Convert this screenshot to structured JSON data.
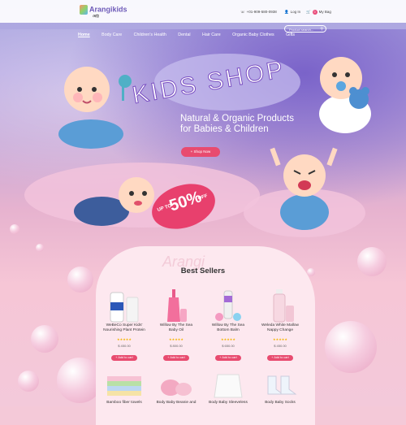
{
  "header": {
    "logo_text": "Arangikids",
    "logo_sub": "ছোট্ট",
    "phone": "+01-909-580-0938",
    "login": "Log In",
    "bag_count": "0",
    "bag": "My Bag"
  },
  "nav": {
    "items": [
      "Home",
      "Body Care",
      "Children's Health",
      "Dental",
      "Hair Care",
      "Organic Baby Clothes",
      "Gifts"
    ],
    "active": "Home",
    "search_placeholder": "Product search..."
  },
  "hero": {
    "title": "KIDS SHOP",
    "headline_line1": "Natural & Organic Products",
    "headline_line2": "for Babies & Children",
    "cta": "+ Shop Now",
    "promo_upto": "UP TO",
    "promo_pct": "50%",
    "promo_off": "OFF"
  },
  "best_sellers": {
    "title": "Best Sellers",
    "watermark": "Arangi",
    "products": [
      {
        "name_line1": "WeBeCo Super Kids'",
        "name_line2": "Nourishing Plant Protein",
        "stars": "★★★★★",
        "price": "$ 450.00",
        "cart": "+ Add to cart"
      },
      {
        "name_line1": "Willow By The Sea",
        "name_line2": "Baby Oil",
        "stars": "★★★★★",
        "price": "$ 800.00",
        "cart": "+ Add to cart"
      },
      {
        "name_line1": "Willow By The Sea",
        "name_line2": "Bottom Balm",
        "stars": "★★★★★",
        "price": "$ 650.00",
        "cart": "+ Add to cart"
      },
      {
        "name_line1": "Weleda White Mallow",
        "name_line2": "Nappy Change",
        "stars": "★★★★★",
        "price": "$ 450.00",
        "cart": "+ Add to cart"
      }
    ],
    "row2": [
      "Bamboo fiber towels",
      "Body Baby Beanie and",
      "Body Baby Sleeveless",
      "Body Baby Socks"
    ]
  },
  "colors": {
    "accent": "#e84b6f",
    "brand": "#6e5bb8"
  }
}
